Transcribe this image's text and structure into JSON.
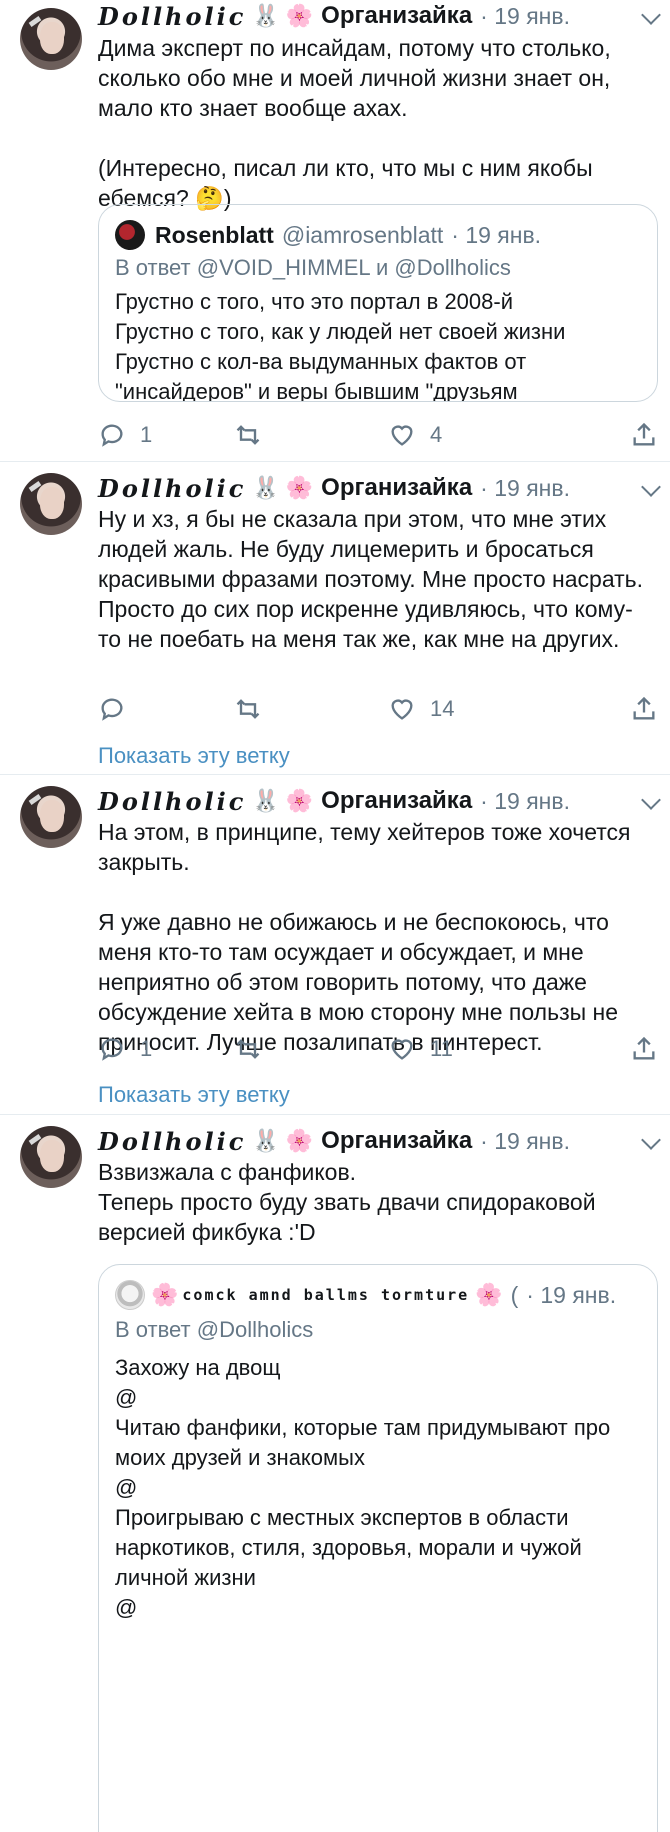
{
  "author": {
    "handle_fancy": "Dollholic",
    "emoji_1": "🐰",
    "emoji_2": "🌸",
    "name": "Организайка"
  },
  "tweets": [
    {
      "time": "· 19 янв.",
      "text": "Дима эксперт по инсайдам, потому что столько, сколько обо мне и моей личной жизни знает он, мало кто знает вообще ахах.\n\n(Интересно, писал ли кто, что мы с ним якобы ебемся? 🤔)",
      "quote": {
        "name": "Rosenblatt",
        "handle": "@iamrosenblatt",
        "time": "· 19 янв.",
        "reply_to": "В ответ @VOID_HIMMEL и @Dollholics",
        "text": "Грустно с того, что это портал в 2008-й\nГрустно с того, как у людей нет своей жизни\nГрустно с кол-ва выдуманных фактов от \"инсайдеров\" и веры бывшим \"друзьям"
      },
      "replies": "1",
      "retweets": "",
      "likes": "4"
    },
    {
      "time": "· 19 янв.",
      "text": "Ну и хз, я бы не сказала при этом, что мне этих людей жаль. Не буду лицемерить и бросаться красивыми фразами поэтому. Мне просто насрать.\nПросто до сих пор искренне удивляюсь, что кому-то не поебать на меня так же, как мне на других.",
      "replies": "",
      "retweets": "",
      "likes": "14",
      "show_thread": "Показать эту ветку"
    },
    {
      "time": "· 19 янв.",
      "text": "На этом, в принципе, тему хейтеров тоже хочется закрыть.\n\nЯ уже давно не обижаюсь и не беспокоюсь, что меня кто-то там осуждает и обсуждает, и мне неприятно об этом говорить потому, что даже обсуждение хейта в мою сторону мне пользы не приносит. Лучше позалипать в пинтерест.",
      "replies": "1",
      "retweets": "",
      "likes": "11",
      "show_thread": "Показать эту ветку"
    },
    {
      "time": "· 19 янв.",
      "text": "Взвизжала с фанфиков.\nТеперь просто буду звать двачи спидораковой версией фикбука :'D",
      "quote": {
        "flower": "🌸",
        "name_fancy": "comck amnd ballms tormture",
        "flower_2": "🌸",
        "trail": "(",
        "time": "· 19 янв.",
        "reply_to": "В ответ @Dollholics",
        "text": "Захожу на двощ\n@\nЧитаю фанфики, которые там придумывают про моих друзей и знакомых\n@\nПроигрываю с местных экспертов в области наркотиков, стиля, здоровья, морали и чужой личной жизни\n@"
      }
    }
  ],
  "icons": [
    "reply-icon",
    "retweet-icon",
    "like-icon",
    "share-icon",
    "chevron-down-icon"
  ],
  "colors": {
    "link": "#4a90c2",
    "muted": "#657786",
    "divider": "#e6ecf0"
  }
}
